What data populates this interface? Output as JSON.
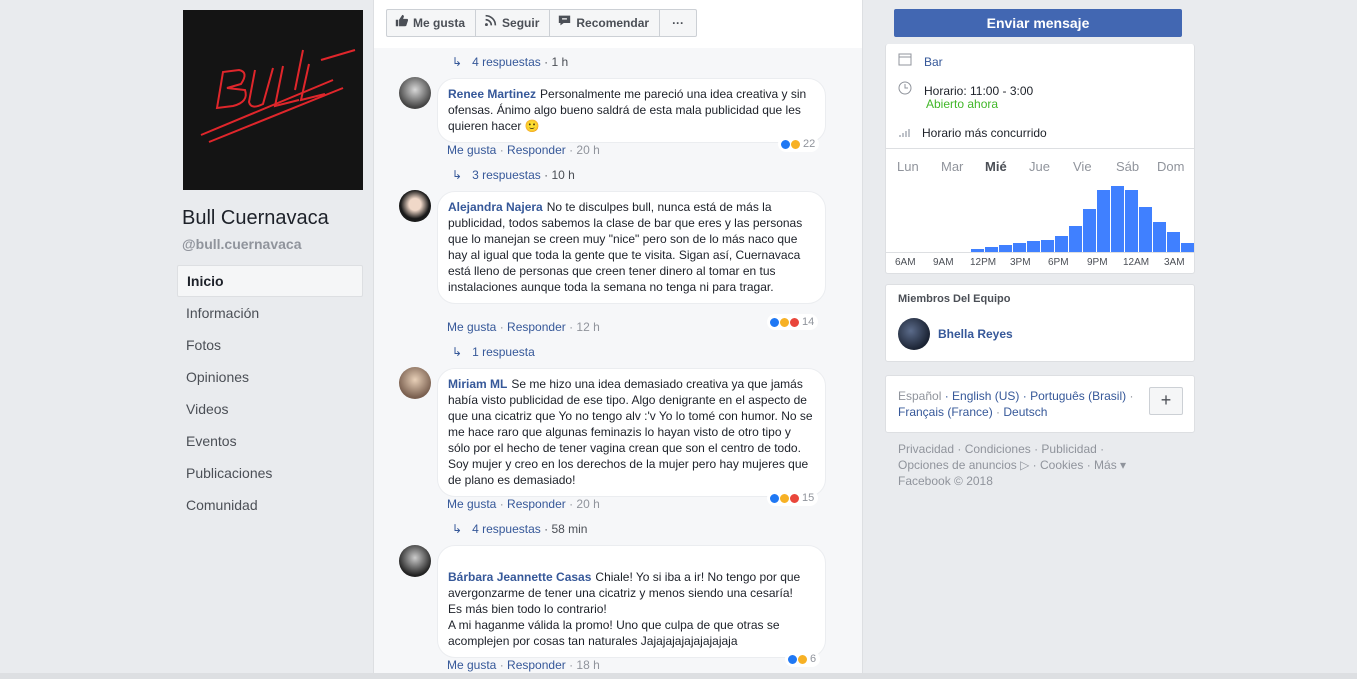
{
  "page": {
    "name": "Bull Cuernavaca",
    "handle": "@bull.cuernavaca",
    "logo_text": "BULL"
  },
  "nav": {
    "items": [
      {
        "label": "Inicio",
        "active": true
      },
      {
        "label": "Información"
      },
      {
        "label": "Fotos"
      },
      {
        "label": "Opiniones"
      },
      {
        "label": "Videos"
      },
      {
        "label": "Eventos"
      },
      {
        "label": "Publicaciones"
      },
      {
        "label": "Comunidad"
      }
    ]
  },
  "actions": {
    "like": "Me gusta",
    "follow": "Seguir",
    "recommend": "Recomendar",
    "more": "···"
  },
  "send_message": "Enviar mensaje",
  "comments": {
    "top_replies": {
      "count": "4 respuestas",
      "time": "1 h"
    },
    "items": [
      {
        "author": "Renee Martinez",
        "text": "Personalmente me pareció una idea creativa y sin ofensas. Ánimo algo bueno saldrá de esta mala publicidad que les quieren hacer",
        "emoji": "🙂",
        "like": "Me gusta",
        "reply": "Responder",
        "time": "20 h",
        "reactions": "22",
        "replies": "3 respuestas",
        "replies_time": "10 h"
      },
      {
        "author": "Alejandra Najera",
        "text": "No te disculpes bull, nunca está de más la publicidad, todos sabemos la clase de bar que eres y las personas que lo manejan se creen muy \"nice\" pero son de lo más naco que hay al igual que toda la gente que te visita. Sigan así, Cuernavaca está lleno de personas que creen tener dinero al tomar en tus instalaciones aunque toda la semana no tenga ni para tragar.",
        "like": "Me gusta",
        "reply": "Responder",
        "time": "12 h",
        "reactions": "14",
        "replies": "1 respuesta",
        "replies_time": ""
      },
      {
        "author": "Miriam ML",
        "text": "Se me hizo una idea demasiado creativa ya que jamás había visto publicidad de ese tipo. Algo denigrante en el aspecto de que una cicatriz que Yo no tengo alv :'v Yo lo tomé con humor. No se me hace raro que algunas feminazis lo hayan visto de otro tipo y sólo por el hecho de tener vagina crean que son el centro de todo. Soy mujer y creo en los derechos de la mujer pero hay mujeres que de plano es demasiado!",
        "like": "Me gusta",
        "reply": "Responder",
        "time": "20 h",
        "reactions": "15",
        "replies": "4 respuestas",
        "replies_time": "58 min"
      },
      {
        "author": "Bárbara Jeannette Casas",
        "text": "Chiale! Yo si iba a ir! No tengo por que avergonzarme de tener una cicatriz y menos siendo una cesaría!\nEs más bien todo lo contrario!\nA mi haganme válida la promo! Uno que culpa de que otras se acomplejen por cosas tan naturales Jajajajajajajajajaja",
        "like": "Me gusta",
        "reply": "Responder",
        "time": "18 h",
        "reactions": "6"
      }
    ]
  },
  "info": {
    "category": "Bar",
    "hours": "Horario: 11:00 - 3:00",
    "open_now": "Abierto ahora",
    "busiest": "Horario más concurrido"
  },
  "chart_data": {
    "type": "bar",
    "days": [
      "Lun",
      "Mar",
      "Mié",
      "Jue",
      "Vie",
      "Sáb",
      "Dom"
    ],
    "selected_day": "Mié",
    "tick_labels": [
      "6AM",
      "9AM",
      "12PM",
      "3PM",
      "6PM",
      "9PM",
      "12AM",
      "3AM"
    ],
    "values": [
      0,
      0,
      0,
      0,
      0,
      0,
      4,
      7,
      10,
      13,
      15,
      17,
      22,
      36,
      60,
      86,
      92,
      86,
      62,
      42,
      28,
      12
    ],
    "ylim": [
      0,
      100
    ]
  },
  "team": {
    "title": "Miembros Del Equipo",
    "member": "Bhella Reyes"
  },
  "languages": {
    "current": "Español",
    "others": [
      "English (US)",
      "Português (Brasil)",
      "Français (France)",
      "Deutsch"
    ],
    "plus": "+"
  },
  "footer": {
    "links": [
      "Privacidad",
      "Condiciones",
      "Publicidad",
      "Opciones de anuncios",
      "Cookies",
      "Más"
    ],
    "copyright": "Facebook © 2018"
  },
  "colors": {
    "brand": "#4267b2",
    "link": "#365899",
    "open": "#42b72a",
    "bar": "#4080ff",
    "logo_red": "#e0262b"
  }
}
